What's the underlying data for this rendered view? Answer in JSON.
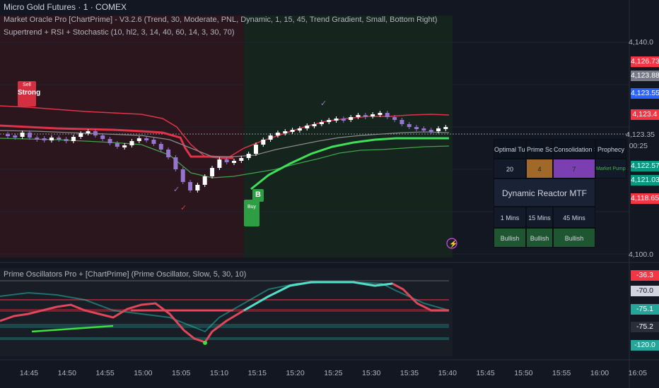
{
  "window": {
    "title": "Micro Gold Futures · 1 · COMEX"
  },
  "legends": {
    "market_oracle": "Market Oracle Pro [ChartPrime] - V3.2.6 (Trend, 30, Moderate, PNL, Dynamic, 1, 15, 45, Trend Gradient, Small, Bottom Right)",
    "supertrend": "Supertrend + RSI + Stochastic (10, hl2, 3, 14, 40, 60, 14, 3, 30, 70)",
    "prime_osc": "Prime Oscillators Pro + [ChartPrime] (Prime Oscillator, Slow, 5, 30, 10)"
  },
  "price_axis": {
    "top": "4,140.0",
    "current_area": "4,123.35",
    "timer": "00:25",
    "bottom": "4,100.0",
    "tags": [
      {
        "value": "4,126.73",
        "color": "#f23645"
      },
      {
        "value": "4,123.88",
        "color": "#787b86"
      },
      {
        "value": "4,123.55",
        "color": "#2962ff"
      },
      {
        "value": "4,123.4",
        "color": "#f23645"
      },
      {
        "value": "4,122.57",
        "color": "#089981"
      },
      {
        "value": "4,121.03",
        "color": "#089981"
      },
      {
        "value": "4,118.65",
        "color": "#f23645"
      }
    ]
  },
  "oscillator_axis": {
    "tags": [
      {
        "value": "-36.3",
        "color": "#f23645"
      },
      {
        "value": "-70.0",
        "color": "#d1d4dc"
      },
      {
        "value": "-75.1",
        "color": "#26a69a"
      },
      {
        "value": "-75.2",
        "color": "#2a2e39"
      },
      {
        "value": "-120.0",
        "color": "#26a69a"
      }
    ]
  },
  "time_axis": [
    "14:45",
    "14:50",
    "14:55",
    "15:00",
    "15:05",
    "15:10",
    "15:15",
    "15:20",
    "15:25",
    "15:30",
    "15:35",
    "15:40",
    "15:45",
    "15:50",
    "15:55",
    "16:00",
    "16:05"
  ],
  "signals": {
    "strong_label": "Strong",
    "sell_small": "Sell",
    "buy_label": "B",
    "buy_small": "Buy"
  },
  "table": {
    "headers": [
      "Optimal Tuning",
      "Prime Score",
      "Consolidation  Score",
      "Prophecy"
    ],
    "values": [
      "20",
      "4",
      "7",
      "Market Pumps"
    ],
    "mtf_title": "Dynamic Reactor MTF",
    "mtf_headers": [
      "1 Mins",
      "15 Mins",
      "45 Mins"
    ],
    "mtf_values": [
      "Bullish",
      "Bullish",
      "Bullish"
    ],
    "colors": {
      "prime": "#a0692a",
      "consolidation": "#7b3fb2",
      "prophecy_text": "#4caf50",
      "bullish_bg": "#1e5631"
    }
  },
  "colors": {
    "up": "#ffffff",
    "down": "#9575cd",
    "red_line": "#e0334a",
    "green_line": "#3fa34d",
    "gray_line": "#8a8a8a"
  }
}
